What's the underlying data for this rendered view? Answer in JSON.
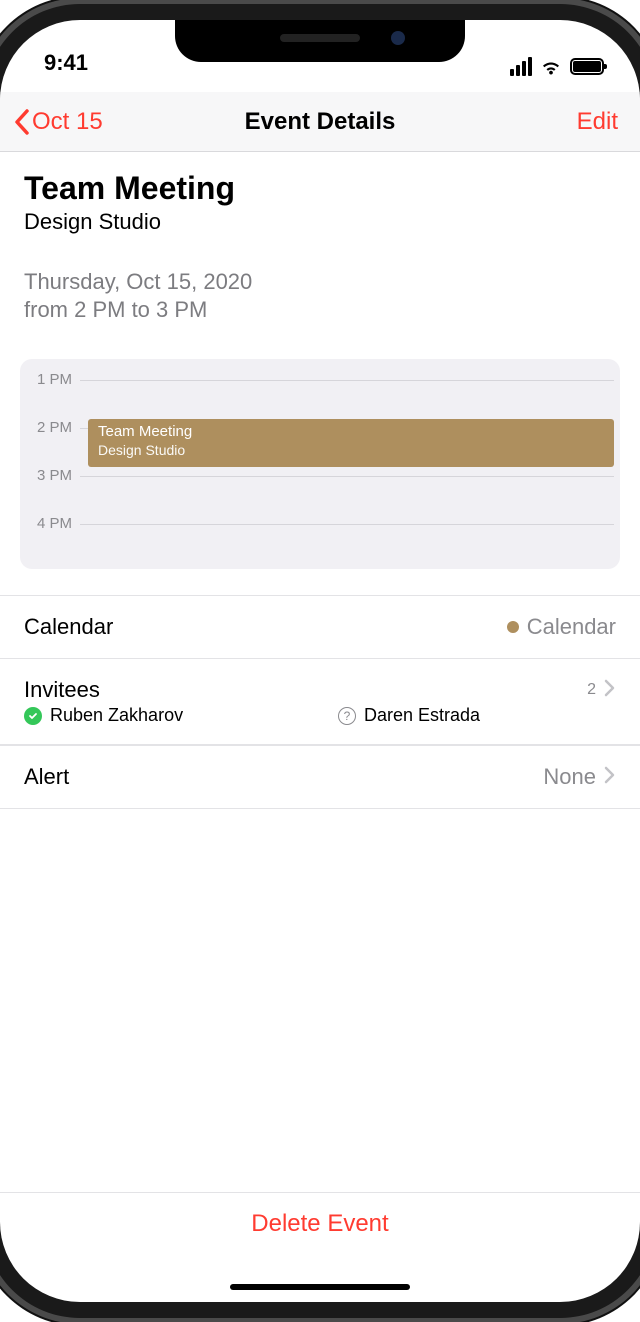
{
  "status": {
    "time": "9:41"
  },
  "nav": {
    "back_label": "Oct 15",
    "title": "Event Details",
    "edit_label": "Edit"
  },
  "event": {
    "title": "Team Meeting",
    "location": "Design Studio",
    "date_line": "Thursday, Oct 15, 2020",
    "time_line": "from 2 PM to 3 PM"
  },
  "timeline": {
    "slots": [
      "1 PM",
      "2 PM",
      "3 PM",
      "4 PM"
    ],
    "block_title": "Team Meeting",
    "block_subtitle": "Design Studio"
  },
  "calendar_row": {
    "label": "Calendar",
    "value": "Calendar",
    "dot_color": "#ae8f5e"
  },
  "invitees": {
    "label": "Invitees",
    "count": "2",
    "people": [
      {
        "name": "Ruben Zakharov",
        "status": "accepted"
      },
      {
        "name": "Daren Estrada",
        "status": "pending"
      }
    ]
  },
  "alert_row": {
    "label": "Alert",
    "value": "None"
  },
  "footer": {
    "delete_label": "Delete Event"
  }
}
